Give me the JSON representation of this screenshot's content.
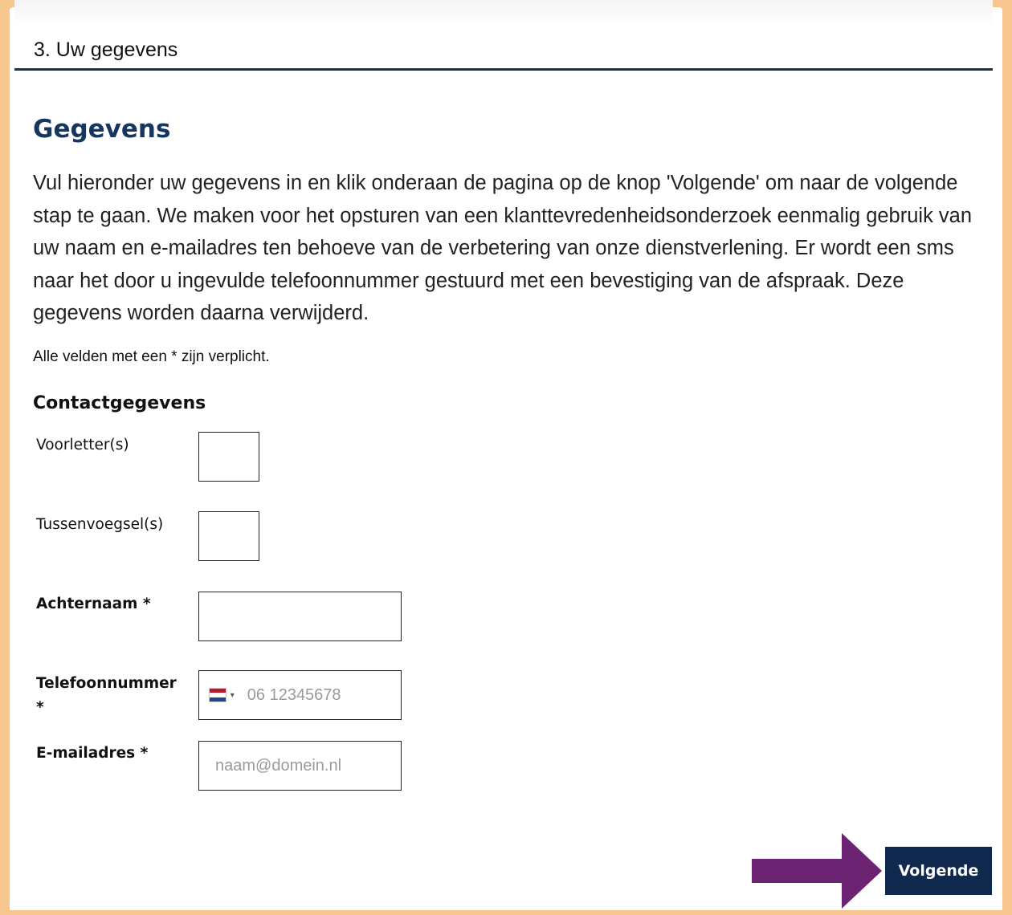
{
  "step": {
    "title": "3. Uw gegevens"
  },
  "main": {
    "title": "Gegevens",
    "intro": "Vul hieronder uw gegevens in en klik onderaan de pagina op de knop 'Volgende' om naar de volgende stap te gaan. We maken voor het opsturen van een klanttevredenheidsonderzoek eenmalig gebruik van uw naam en e-mailadres ten behoeve van de verbetering van onze dienstverlening. Er wordt een sms naar het door u ingevulde telefoonnummer gestuurd met een bevestiging van de afspraak. Deze gegevens worden daarna verwijderd.",
    "required_note": "Alle velden met een * zijn verplicht."
  },
  "contact": {
    "section_title": "Contactgegevens",
    "initials": {
      "label": "Voorletter(s)",
      "value": ""
    },
    "infix": {
      "label": "Tussenvoegsel(s)",
      "value": ""
    },
    "surname": {
      "label": "Achternaam  *",
      "value": ""
    },
    "phone": {
      "label": "Telefoonnummer *",
      "value": "",
      "placeholder": "06 12345678",
      "country_flag": "netherlands-flag-icon"
    },
    "email": {
      "label": "E-mailadres  *",
      "value": "",
      "placeholder": "naam@domein.nl"
    }
  },
  "actions": {
    "next_label": "Volgende"
  },
  "colors": {
    "page_background": "#f7c68f",
    "header_rule": "#1c2f4f",
    "title": "#163660",
    "button": "#0f2a4e",
    "annotation_arrow": "#6b2372"
  }
}
